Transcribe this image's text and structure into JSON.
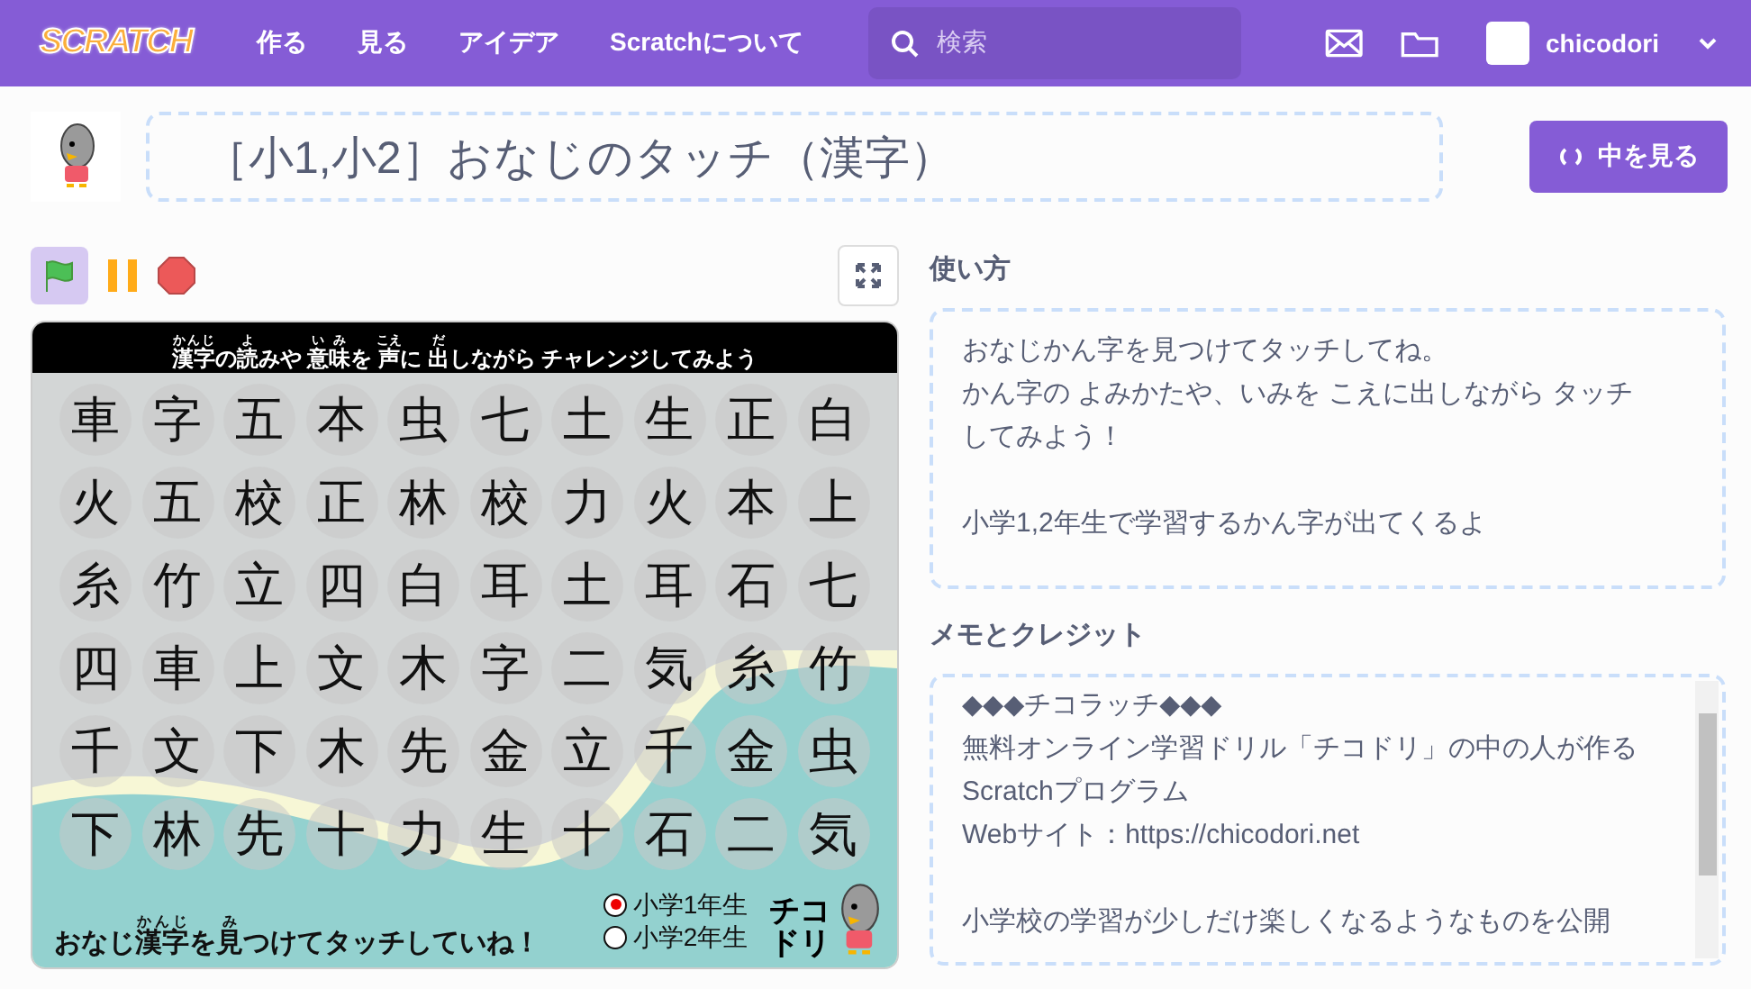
{
  "nav": {
    "logo": "SCRATCH",
    "links": [
      "作る",
      "見る",
      "アイデア",
      "Scratchについて"
    ],
    "search": {
      "placeholder": "検索"
    },
    "username": "chicodori"
  },
  "project": {
    "title": "［小1,小2］おなじのタッチ（漢字）",
    "see_inside": "中を見る"
  },
  "stage": {
    "header": [
      {
        "text": "漢字",
        "ruby": "かんじ"
      },
      {
        "text": "の"
      },
      {
        "text": "読",
        "ruby": "よ"
      },
      {
        "text": "みや "
      },
      {
        "text": "意味",
        "ruby": "いみ"
      },
      {
        "text": "を "
      },
      {
        "text": "声",
        "ruby": "こえ"
      },
      {
        "text": "に "
      },
      {
        "text": "出",
        "ruby": "だ"
      },
      {
        "text": "しながら チャレンジしてみよう"
      }
    ],
    "grid": [
      [
        "車",
        "字",
        "五",
        "本",
        "虫",
        "七",
        "土",
        "生",
        "正",
        "白"
      ],
      [
        "火",
        "五",
        "校",
        "正",
        "林",
        "校",
        "力",
        "火",
        "本",
        "上"
      ],
      [
        "糸",
        "竹",
        "立",
        "四",
        "白",
        "耳",
        "土",
        "耳",
        "石",
        "七"
      ],
      [
        "四",
        "車",
        "上",
        "文",
        "木",
        "字",
        "二",
        "気",
        "糸",
        "竹"
      ],
      [
        "千",
        "文",
        "下",
        "木",
        "先",
        "金",
        "立",
        "千",
        "金",
        "虫"
      ],
      [
        "下",
        "林",
        "先",
        "十",
        "力",
        "生",
        "十",
        "石",
        "二",
        "気"
      ]
    ],
    "footer": [
      {
        "text": "おなじ"
      },
      {
        "text": "漢字",
        "ruby": "かんじ"
      },
      {
        "text": "を"
      },
      {
        "text": "見",
        "ruby": "み"
      },
      {
        "text": "つけてタッチしていね！"
      }
    ],
    "levels": [
      {
        "label": "小学1年生",
        "selected": true
      },
      {
        "label": "小学2年生",
        "selected": false
      }
    ],
    "logo_lines": [
      "チコ",
      "ドリ"
    ]
  },
  "instructions": {
    "heading": "使い方",
    "paragraphs": [
      [
        "おなじかん字を見つけてタッチしてね。",
        "かん字の よみかたや、いみを こえに出しながら タッチしてみよう！"
      ],
      [
        "小学1,2年生で学習するかん字が出てくるよ"
      ]
    ]
  },
  "notes": {
    "heading": "メモとクレジット",
    "paragraphs": [
      [
        "◆◆◆チコラッチ◆◆◆",
        "無料オンライン学習ドリル「チコドリ」の中の人が作るScratchプログラム",
        "Webサイト：https://chicodori.net"
      ],
      [
        "小学校の学習が少しだけ楽しくなるようなものを公開"
      ]
    ]
  }
}
